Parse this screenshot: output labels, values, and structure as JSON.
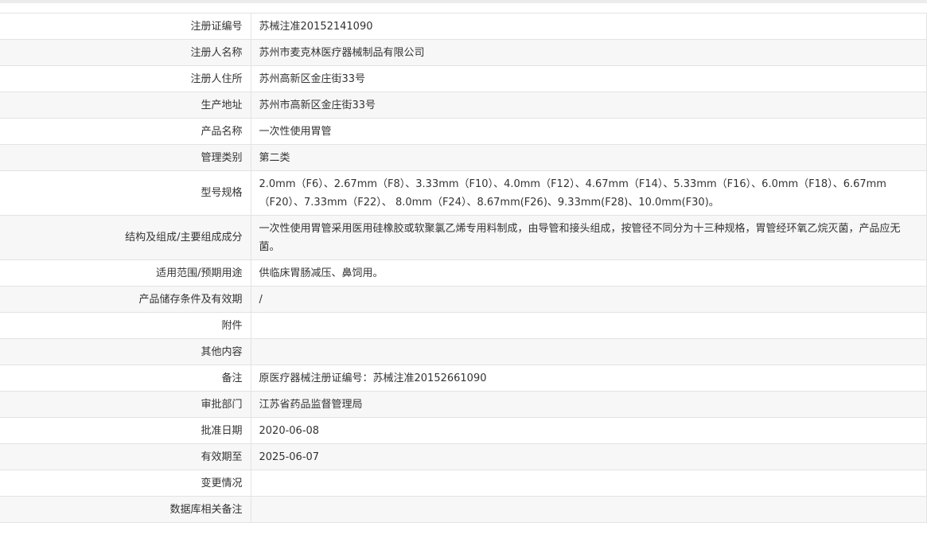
{
  "rows": [
    {
      "label": "注册证编号",
      "value": "苏械注准20152141090"
    },
    {
      "label": "注册人名称",
      "value": "苏州市麦克林医疗器械制品有限公司"
    },
    {
      "label": "注册人住所",
      "value": "苏州高新区金庄街33号"
    },
    {
      "label": "生产地址",
      "value": "苏州市高新区金庄街33号"
    },
    {
      "label": "产品名称",
      "value": "一次性使用胃管"
    },
    {
      "label": "管理类别",
      "value": "第二类"
    },
    {
      "label": "型号规格",
      "value": "2.0mm（F6）、2.67mm（F8）、3.33mm（F10）、4.0mm（F12）、4.67mm（F14）、5.33mm（F16）、6.0mm（F18）、6.67mm（F20）、7.33mm（F22）、 8.0mm（F24）、8.67mm(F26)、9.33mm(F28)、10.0mm(F30)。"
    },
    {
      "label": "结构及组成/主要组成成分",
      "value": "一次性使用胃管采用医用硅橡胶或软聚氯乙烯专用料制成，由导管和接头组成，按管径不同分为十三种规格，胃管经环氧乙烷灭菌，产品应无菌。"
    },
    {
      "label": "适用范围/预期用途",
      "value": "供临床胃肠减压、鼻饲用。"
    },
    {
      "label": "产品储存条件及有效期",
      "value": "/"
    },
    {
      "label": "附件",
      "value": ""
    },
    {
      "label": "其他内容",
      "value": ""
    },
    {
      "label": "备注",
      "value": "原医疗器械注册证编号：苏械注准20152661090"
    },
    {
      "label": "审批部门",
      "value": "江苏省药品监督管理局"
    },
    {
      "label": "批准日期",
      "value": "2020-06-08"
    },
    {
      "label": "有效期至",
      "value": "2025-06-07"
    },
    {
      "label": "变更情况",
      "value": ""
    },
    {
      "label": "数据库相关备注",
      "value": ""
    }
  ]
}
